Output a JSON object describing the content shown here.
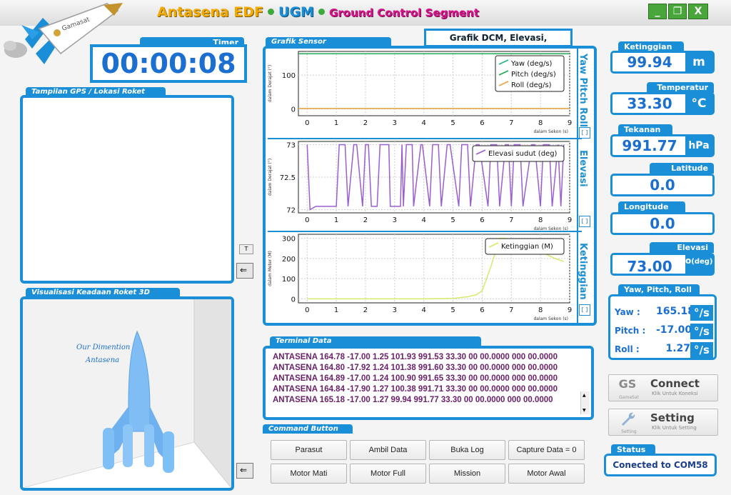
{
  "titlebar": {
    "part1": "Antasena EDF",
    "part2": "UGM",
    "part3": "Ground Control Segment",
    "logo_text": "Gamasat",
    "min_label": "_",
    "max_label": "❐",
    "close_label": "X"
  },
  "timer": {
    "tab": "Timer",
    "value": "00:00:08"
  },
  "gps": {
    "tab": "Tampilan GPS / Lokasi Roket",
    "t_button": "T"
  },
  "viz3d": {
    "tab": "Visualisasi Keadaan Roket 3D",
    "caption_line1": "Our Dimention",
    "caption_line2": "Antasena"
  },
  "grafik": {
    "tab": "Grafik Sensor",
    "dcm_title": "Grafik DCM, Elevasi, Ketinggian",
    "side1": "Yaw Pitch Roll",
    "side2": "Elevasi",
    "side3": "Ketinggian",
    "expand": "[ ]"
  },
  "chart_data": [
    {
      "type": "line",
      "ylabel": "dalam Derajat (°)",
      "xlabel": "dalam Sekon (s)",
      "xlim": [
        -0.3,
        9
      ],
      "ylim": [
        -20,
        170
      ],
      "xticks": [
        "0",
        "1",
        "2",
        "3",
        "4",
        "5",
        "6",
        "7",
        "8",
        "9"
      ],
      "yticks": [
        "100",
        "0"
      ],
      "series": [
        {
          "name": "Yaw (deg/s)",
          "color": "#1fb389",
          "x": [
            -0.3,
            9
          ],
          "y": [
            163,
            163
          ]
        },
        {
          "name": "Pitch (deg/s)",
          "color": "#20a854",
          "x": [
            -0.3,
            9
          ],
          "y": [
            163,
            163
          ]
        },
        {
          "name": "Roll (deg/s)",
          "color": "#e8a23a",
          "x": [
            -0.3,
            9
          ],
          "y": [
            1.25,
            1.25
          ]
        }
      ]
    },
    {
      "type": "line",
      "ylabel": "dalam Derajat (°)",
      "xlabel": "dalam Sekon (s)",
      "xlim": [
        -0.3,
        9
      ],
      "ylim": [
        71.95,
        73.05
      ],
      "xticks": [
        "0",
        "1",
        "2",
        "3",
        "4",
        "5",
        "6",
        "7",
        "8",
        "9"
      ],
      "yticks": [
        "73",
        "72.5",
        "72"
      ],
      "series": [
        {
          "name": "Elevasi sudut (deg)",
          "color": "#9a5ed1",
          "x": [
            0,
            0.1,
            0.3,
            0.35,
            0.6,
            0.9,
            1,
            1.1,
            1.3,
            1.4,
            1.6,
            1.7,
            1.9,
            2.0,
            2.1,
            2.2,
            2.4,
            2.5,
            2.8,
            2.85,
            3.2,
            3.25,
            3.3,
            3.4,
            3.6,
            3.65,
            3.9,
            3.95,
            4.2,
            4.3,
            4.5,
            4.6,
            4.8,
            4.9,
            5.2,
            5.3,
            5.5,
            5.6,
            5.8,
            5.9,
            6.2,
            6.3,
            6.5,
            6.6,
            6.8,
            6.9,
            7.0,
            7.1,
            7.3,
            7.4,
            7.7,
            7.8,
            8.0,
            8.1,
            8.3,
            8.4,
            8.6,
            8.7,
            8.8
          ],
          "y": [
            73,
            72,
            72.05,
            72.05,
            72.05,
            72.05,
            72.05,
            73,
            73,
            72.05,
            73,
            73,
            72.05,
            73,
            73,
            72.05,
            72.05,
            73,
            73,
            72.05,
            72.05,
            73,
            72.05,
            73,
            73,
            72.05,
            73,
            73,
            72.05,
            73,
            73,
            72.05,
            73,
            73,
            72.05,
            73,
            73,
            72.05,
            73,
            73,
            72.05,
            73,
            73,
            72.05,
            73,
            73,
            72.05,
            73,
            73,
            72.05,
            73,
            73,
            72.05,
            73,
            73,
            72.05,
            73,
            72.05,
            73
          ]
        }
      ]
    },
    {
      "type": "line",
      "ylabel": "dalam Meter (M)",
      "xlabel": "dalam Sekon (s)",
      "xlim": [
        -0.3,
        9
      ],
      "ylim": [
        -20,
        320
      ],
      "xticks": [
        "0",
        "1",
        "2",
        "3",
        "4",
        "5",
        "6",
        "7",
        "8",
        "9"
      ],
      "yticks": [
        "300",
        "200",
        "100",
        "0"
      ],
      "series": [
        {
          "name": "Ketinggian (M)",
          "color": "#d7ea6b",
          "x": [
            0,
            1,
            2,
            3,
            4,
            5,
            5.5,
            5.8,
            6.0,
            6.3,
            6.6,
            6.8,
            7.2,
            8.0,
            8.5,
            8.8
          ],
          "y": [
            0,
            0,
            0,
            0,
            0,
            2,
            10,
            20,
            40,
            160,
            300,
            300,
            250,
            235,
            200,
            185
          ]
        }
      ]
    }
  ],
  "terminal": {
    "tab": "Terminal Data",
    "lines": [
      "ANTASENA 164.78 -17.00 1.25 101.93 991.53 33.30 00 00.0000 000 00.0000",
      "ANTASENA 164.80 -17.92 1.24 101.38 991.60 33.30 00 00.0000 000 00.0000",
      "ANTASENA 164.89 -17.00 1.24 100.90 991.65 33.30 00 00.0000 000 00.0000",
      "ANTASENA 164.84 -17.90 1.27 100.38 991.71 33.30 00 00.0000 000 00.0000",
      "ANTASENA 165.18 -17.00 1.27 99.94 991.77 33.30 00 00.0000 000 00.0000"
    ]
  },
  "commands": {
    "tab": "Command Button",
    "buttons": [
      "Parasut",
      "Ambil Data",
      "Buka Log",
      "Capture Data = 0",
      "Motor Mati",
      "Motor Full",
      "Mission",
      "Motor Awal"
    ]
  },
  "readouts": {
    "ketinggian": {
      "label": "Ketinggian",
      "value": "99.94",
      "unit": "m"
    },
    "temperatur": {
      "label": "Temperatur",
      "value": "33.30",
      "unit": "°C"
    },
    "tekanan": {
      "label": "Tekanan",
      "value": "991.77",
      "unit": "hPa"
    },
    "latitude": {
      "label": "Latitude",
      "value": "0.0"
    },
    "longitude": {
      "label": "Longitude",
      "value": "0.0"
    },
    "elevasi": {
      "label": "Elevasi",
      "value": "73.00",
      "unit_sup": "o",
      "unit_sub": "(deg)"
    }
  },
  "ypr": {
    "label": "Yaw, Pitch, Roll",
    "yaw_label": "Yaw :",
    "yaw": "165.18",
    "pitch_label": "Pitch :",
    "pitch": "-17.00",
    "roll_label": "Roll :",
    "roll": "1.27",
    "unit": "°/s"
  },
  "connect": {
    "icon": "GS",
    "icon_caption": "GamaSat",
    "label": "Connect",
    "sub": "Klik Untuk Koneksi"
  },
  "setting": {
    "icon_caption": "Setting",
    "label": "Setting",
    "sub": "Klik Untuk Setting"
  },
  "status": {
    "label": "Status",
    "value": "Conected to COM58"
  }
}
